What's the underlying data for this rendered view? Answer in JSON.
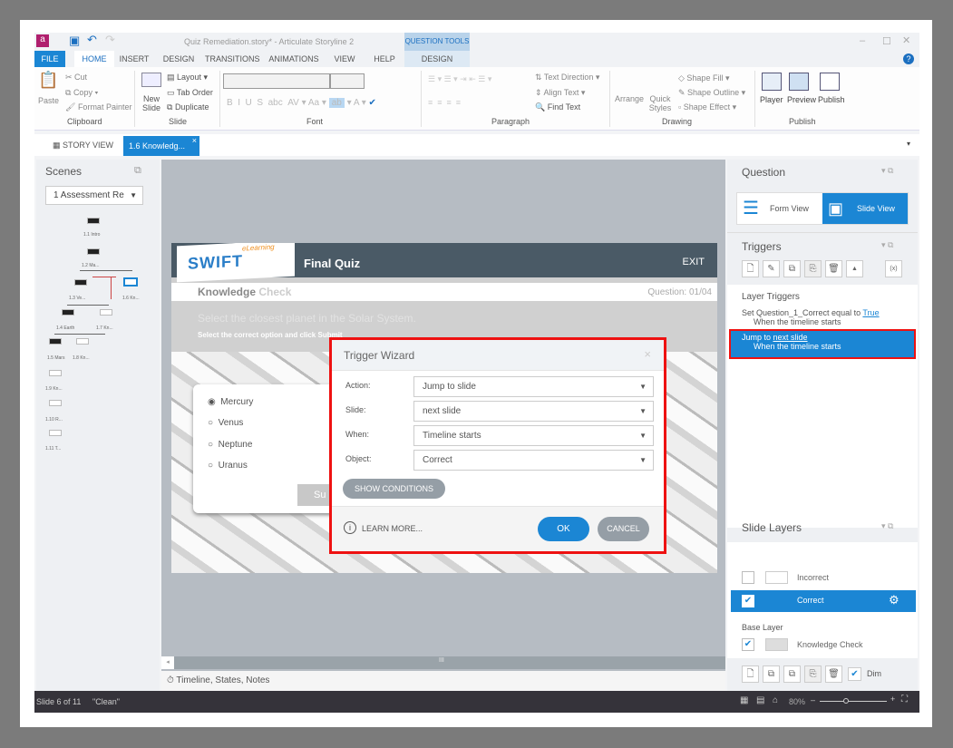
{
  "window": {
    "title": "Quiz Remediation.story* - Articulate Storyline 2",
    "context_tab": "QUESTION TOOLS"
  },
  "ribbon_tabs": [
    "FILE",
    "HOME",
    "INSERT",
    "DESIGN",
    "TRANSITIONS",
    "ANIMATIONS",
    "VIEW",
    "HELP",
    "DESIGN"
  ],
  "ribbon": {
    "clipboard": {
      "paste": "Paste",
      "cut": "Cut",
      "copy": "Copy",
      "format_painter": "Format Painter",
      "label": "Clipboard"
    },
    "slide": {
      "new_slide": "New Slide",
      "layout": "Layout",
      "tab_order": "Tab Order",
      "duplicate": "Duplicate",
      "label": "Slide"
    },
    "font": {
      "label": "Font"
    },
    "paragraph": {
      "text_direction": "Text Direction",
      "align_text": "Align Text",
      "find_text": "Find Text",
      "label": "Paragraph"
    },
    "drawing": {
      "arrange": "Arrange",
      "quick_styles": "Quick Styles",
      "shape_fill": "Shape Fill",
      "shape_outline": "Shape Outline",
      "shape_effect": "Shape Effect",
      "label": "Drawing"
    },
    "publish": {
      "player": "Player",
      "preview": "Preview",
      "publish": "Publish",
      "label": "Publish"
    }
  },
  "doc_tabs": [
    "STORY VIEW",
    "1.6 Knowledg..."
  ],
  "scenes": {
    "title": "Scenes",
    "selected": "1 Assessment Re",
    "nodes": [
      "1.1 Intro",
      "1.2 Ma...",
      "1.6 Kn...",
      "1.3 Ve...",
      "1.4 Earth",
      "1.7 Kn...",
      "1.5 Mars",
      "1.8 Kn...",
      "1.9 Kn...",
      "1.10 R...",
      "1.11 T..."
    ]
  },
  "slide": {
    "brand": "SWIFT",
    "brand_sub": "eLearning",
    "title": "Final Quiz",
    "exit": "EXIT",
    "section_a": "Knowledge",
    "section_b": "Check",
    "counter": "Question: 01/04",
    "question": "Select the closest planet in the Solar System.",
    "instruction": "Select the correct option and click Submit",
    "options": [
      "Mercury",
      "Venus",
      "Neptune",
      "Uranus"
    ],
    "selected_option": 0,
    "submit": "Su"
  },
  "wizard": {
    "title": "Trigger Wizard",
    "fields": [
      {
        "label": "Action:",
        "value": "Jump to slide"
      },
      {
        "label": "Slide:",
        "value": "next slide"
      },
      {
        "label": "When:",
        "value": "Timeline starts"
      },
      {
        "label": "Object:",
        "value": "Correct"
      }
    ],
    "show_conditions": "SHOW CONDITIONS",
    "learn_more": "LEARN MORE...",
    "ok": "OK",
    "cancel": "CANCEL"
  },
  "question_panel": {
    "title": "Question",
    "form_view": "Form View",
    "slide_view": "Slide View"
  },
  "triggers": {
    "title": "Triggers",
    "group": "Layer Triggers",
    "items": [
      {
        "prefix": "Set Question_1_Correct equal to ",
        "link": "True",
        "when": "When the timeline starts"
      },
      {
        "prefix": "Jump to ",
        "link": "next slide",
        "when": "When the timeline starts"
      }
    ]
  },
  "layers": {
    "title": "Slide Layers",
    "items": [
      {
        "name": "Incorrect",
        "checked": false
      },
      {
        "name": "Correct",
        "checked": true
      }
    ],
    "base_label": "Base Layer",
    "base": "Knowledge Check",
    "dim": "Dim"
  },
  "bottom_tab": "Timeline, States, Notes",
  "status": {
    "slide": "Slide 6 of 11",
    "theme": "\"Clean\"",
    "zoom": "80%"
  },
  "colors": {
    "accent": "#1b86d4",
    "highlight": "#e11",
    "header": "#4a5a66"
  }
}
